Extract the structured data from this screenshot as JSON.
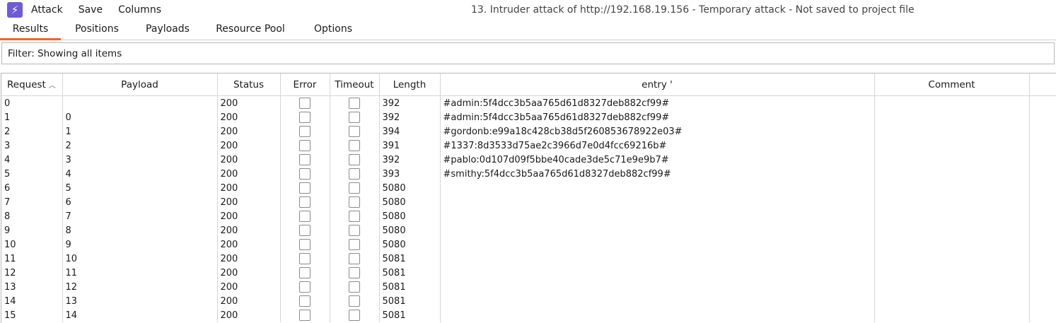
{
  "menu": {
    "app_icon": "lightning-icon",
    "items": [
      "Attack",
      "Save",
      "Columns"
    ],
    "window_title": "13. Intruder attack of http://192.168.19.156 - Temporary attack - Not saved to project file"
  },
  "tabs": [
    "Results",
    "Positions",
    "Payloads",
    "Resource Pool",
    "Options"
  ],
  "active_tab": "Results",
  "filter": {
    "text": "Filter: Showing all items"
  },
  "columns": [
    "Request",
    "Payload",
    "Status",
    "Error",
    "Timeout",
    "Length",
    "entry '",
    "Comment"
  ],
  "sorted_column": "Request",
  "rows": [
    {
      "request": "0",
      "payload": "",
      "status": "200",
      "error": false,
      "timeout": false,
      "length": "392",
      "entry": "#admin:5f4dcc3b5aa765d61d8327deb882cf99#",
      "comment": ""
    },
    {
      "request": "1",
      "payload": "0",
      "status": "200",
      "error": false,
      "timeout": false,
      "length": "392",
      "entry": "#admin:5f4dcc3b5aa765d61d8327deb882cf99#",
      "comment": ""
    },
    {
      "request": "2",
      "payload": "1",
      "status": "200",
      "error": false,
      "timeout": false,
      "length": "394",
      "entry": "#gordonb:e99a18c428cb38d5f260853678922e03#",
      "comment": ""
    },
    {
      "request": "3",
      "payload": "2",
      "status": "200",
      "error": false,
      "timeout": false,
      "length": "391",
      "entry": "#1337:8d3533d75ae2c3966d7e0d4fcc69216b#",
      "comment": ""
    },
    {
      "request": "4",
      "payload": "3",
      "status": "200",
      "error": false,
      "timeout": false,
      "length": "392",
      "entry": "#pablo:0d107d09f5bbe40cade3de5c71e9e9b7#",
      "comment": ""
    },
    {
      "request": "5",
      "payload": "4",
      "status": "200",
      "error": false,
      "timeout": false,
      "length": "393",
      "entry": "#smithy:5f4dcc3b5aa765d61d8327deb882cf99#",
      "comment": ""
    },
    {
      "request": "6",
      "payload": "5",
      "status": "200",
      "error": false,
      "timeout": false,
      "length": "5080",
      "entry": "",
      "comment": ""
    },
    {
      "request": "7",
      "payload": "6",
      "status": "200",
      "error": false,
      "timeout": false,
      "length": "5080",
      "entry": "",
      "comment": ""
    },
    {
      "request": "8",
      "payload": "7",
      "status": "200",
      "error": false,
      "timeout": false,
      "length": "5080",
      "entry": "",
      "comment": ""
    },
    {
      "request": "9",
      "payload": "8",
      "status": "200",
      "error": false,
      "timeout": false,
      "length": "5080",
      "entry": "",
      "comment": ""
    },
    {
      "request": "10",
      "payload": "9",
      "status": "200",
      "error": false,
      "timeout": false,
      "length": "5080",
      "entry": "",
      "comment": ""
    },
    {
      "request": "11",
      "payload": "10",
      "status": "200",
      "error": false,
      "timeout": false,
      "length": "5081",
      "entry": "",
      "comment": ""
    },
    {
      "request": "12",
      "payload": "11",
      "status": "200",
      "error": false,
      "timeout": false,
      "length": "5081",
      "entry": "",
      "comment": ""
    },
    {
      "request": "13",
      "payload": "12",
      "status": "200",
      "error": false,
      "timeout": false,
      "length": "5081",
      "entry": "",
      "comment": ""
    },
    {
      "request": "14",
      "payload": "13",
      "status": "200",
      "error": false,
      "timeout": false,
      "length": "5081",
      "entry": "",
      "comment": ""
    },
    {
      "request": "15",
      "payload": "14",
      "status": "200",
      "error": false,
      "timeout": false,
      "length": "5081",
      "entry": "",
      "comment": ""
    }
  ],
  "colors": {
    "accent": "#f26522",
    "app_icon": "#6e5bd6"
  }
}
